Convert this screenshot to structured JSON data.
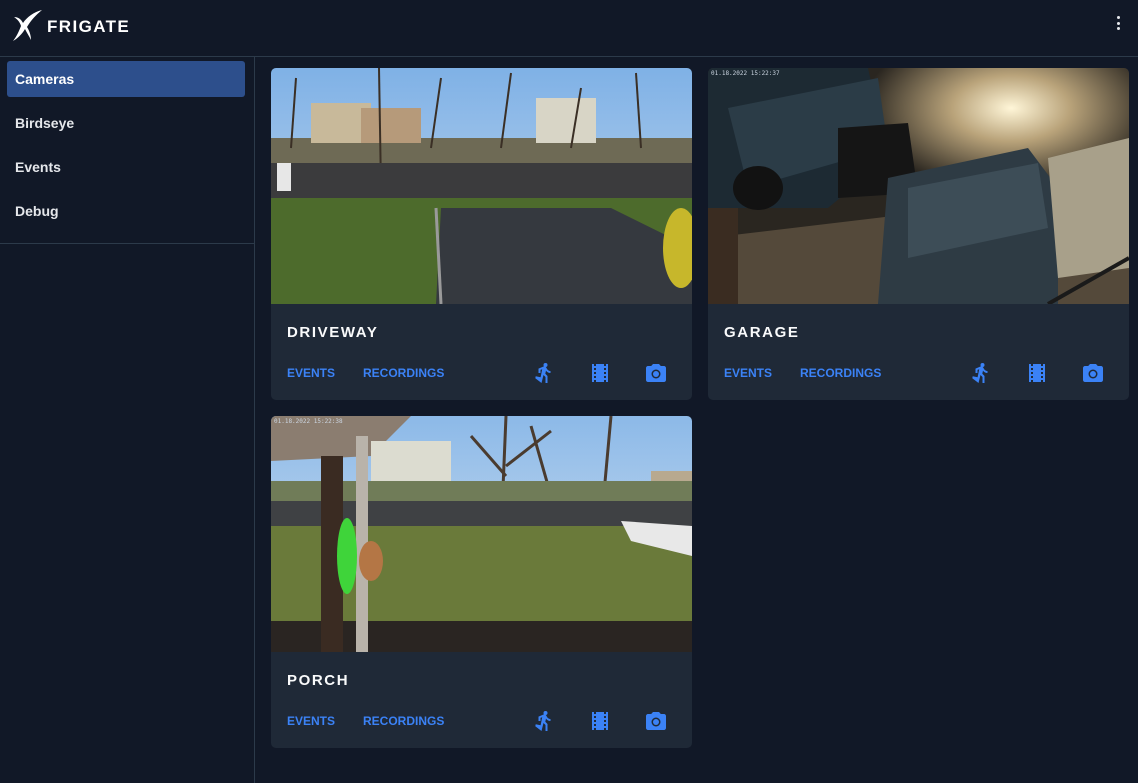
{
  "app": {
    "title": "FRIGATE",
    "logo_icon": "frigate-bird-icon",
    "menu_icon": "kebab-menu-icon"
  },
  "sidebar": {
    "items": [
      {
        "label": "Cameras",
        "active": true
      },
      {
        "label": "Birdseye",
        "active": false
      },
      {
        "label": "Events",
        "active": false
      },
      {
        "label": "Debug",
        "active": false
      }
    ]
  },
  "cameras": [
    {
      "name": "DRIVEWAY",
      "events_label": "EVENTS",
      "recordings_label": "RECORDINGS",
      "icons": [
        "motion-walk-icon",
        "film-clips-icon",
        "camera-snapshot-icon"
      ],
      "timestamp": ""
    },
    {
      "name": "GARAGE",
      "events_label": "EVENTS",
      "recordings_label": "RECORDINGS",
      "icons": [
        "motion-walk-icon",
        "film-clips-icon",
        "camera-snapshot-icon"
      ],
      "timestamp": "01.18.2022 15:22:37"
    },
    {
      "name": "PORCH",
      "events_label": "EVENTS",
      "recordings_label": "RECORDINGS",
      "icons": [
        "motion-walk-icon",
        "film-clips-icon",
        "camera-snapshot-icon"
      ],
      "timestamp": "01.18.2022 15:22:38"
    }
  ],
  "colors": {
    "background": "#111827",
    "card": "#1f2937",
    "accent": "#3b82f6",
    "active_nav": "#2d4f8c"
  }
}
